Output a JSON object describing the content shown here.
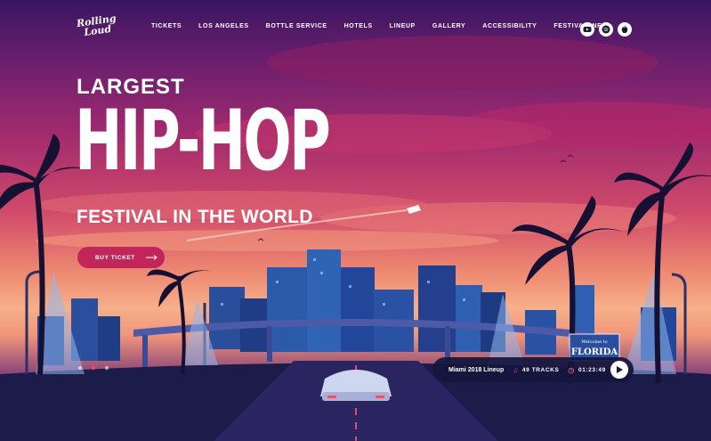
{
  "logo": {
    "line1": "Rolling",
    "line2": "Loud"
  },
  "nav": {
    "items": [
      "TICKETS",
      "LOS ANGELES",
      "BOTTLE SERVICE",
      "HOTELS",
      "LINEUP",
      "GALLERY",
      "ACCESSIBILITY",
      "FESTIVAL INFO"
    ]
  },
  "social": {
    "icons": [
      "youtube-icon",
      "spotify-icon",
      "apple-icon"
    ]
  },
  "hero": {
    "line1": "LARGEST",
    "line2": "HIP-HOP",
    "line3": "FESTIVAL IN THE WORLD",
    "cta": "BUY TICKET"
  },
  "slider": {
    "count": 3,
    "active": 2
  },
  "player": {
    "title": "Miami 2018 Lineup",
    "tracks": "49 TRACKS",
    "time": "01:23:49"
  },
  "sign": {
    "line1": "Welcome to",
    "line2": "FLORIDA"
  },
  "colors": {
    "accent": "#c0265a",
    "player_bg": "#14163c",
    "sky_top": "#3a1660",
    "sky_glow": "#f6b08a"
  }
}
